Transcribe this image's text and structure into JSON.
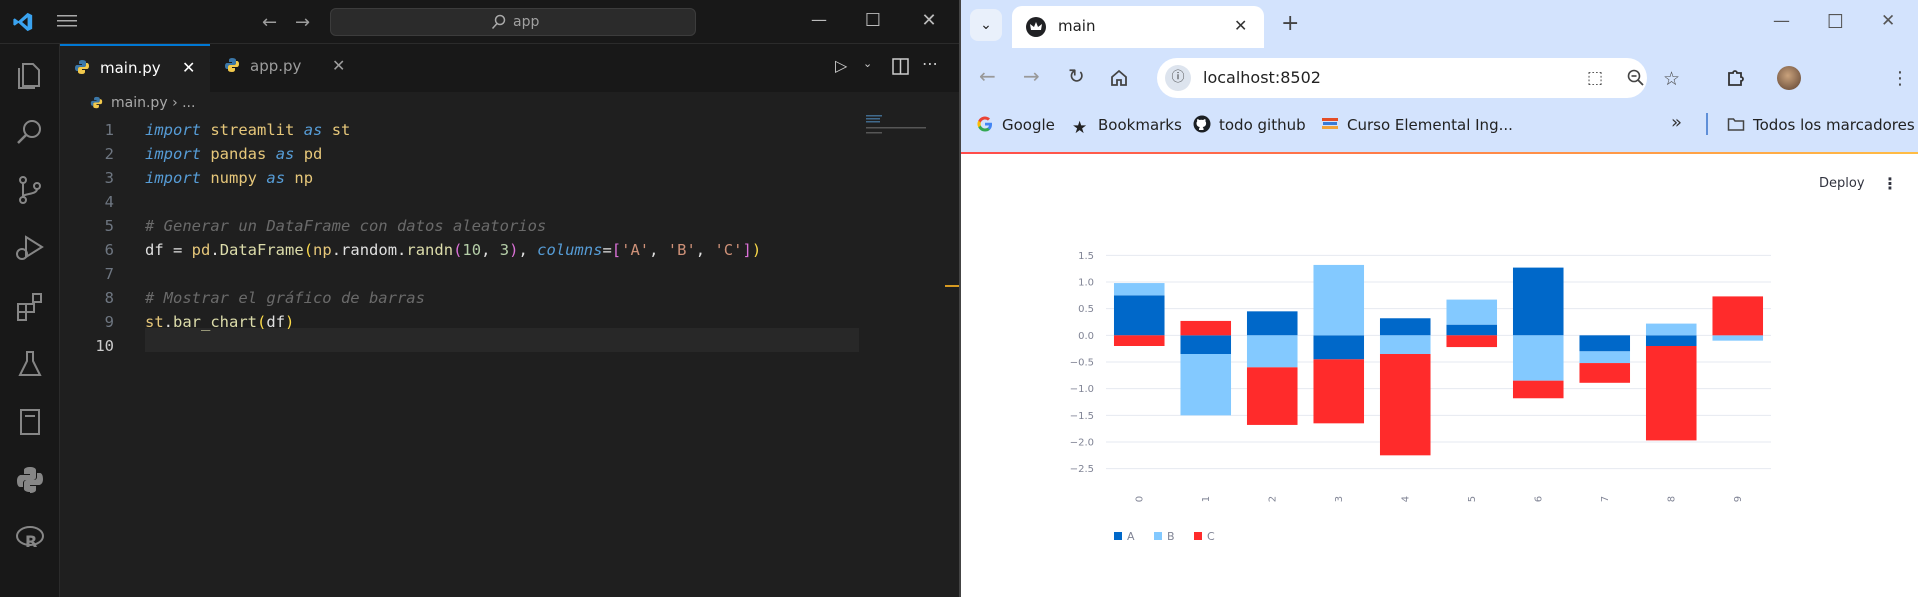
{
  "vscode": {
    "search_text": "app",
    "tabs": [
      {
        "label": "main.py",
        "active": true
      },
      {
        "label": "app.py",
        "active": false
      }
    ],
    "breadcrumb": {
      "file": "main.py",
      "rest": "› ..."
    },
    "code_lines": [
      {
        "n": "1",
        "tokens": [
          [
            "kw",
            "import"
          ],
          [
            "var",
            " "
          ],
          [
            "mod",
            "streamlit"
          ],
          [
            "var",
            " "
          ],
          [
            "kw",
            "as"
          ],
          [
            "var",
            " "
          ],
          [
            "mod",
            "st"
          ]
        ]
      },
      {
        "n": "2",
        "tokens": [
          [
            "kw",
            "import"
          ],
          [
            "var",
            " "
          ],
          [
            "mod",
            "pandas"
          ],
          [
            "var",
            " "
          ],
          [
            "kw",
            "as"
          ],
          [
            "var",
            " "
          ],
          [
            "mod",
            "pd"
          ]
        ]
      },
      {
        "n": "3",
        "tokens": [
          [
            "kw",
            "import"
          ],
          [
            "var",
            " "
          ],
          [
            "mod",
            "numpy"
          ],
          [
            "var",
            " "
          ],
          [
            "kw",
            "as"
          ],
          [
            "var",
            " "
          ],
          [
            "mod",
            "np"
          ]
        ]
      },
      {
        "n": "4",
        "tokens": []
      },
      {
        "n": "5",
        "tokens": [
          [
            "cm",
            "# Generar un DataFrame con datos aleatorios"
          ]
        ]
      },
      {
        "n": "6",
        "tokens": [
          [
            "var",
            "df = "
          ],
          [
            "mod",
            "pd"
          ],
          [
            "var",
            "."
          ],
          [
            "fn",
            "DataFrame"
          ],
          [
            "par",
            "("
          ],
          [
            "mod",
            "np"
          ],
          [
            "var",
            "."
          ],
          [
            "var",
            "random"
          ],
          [
            "var",
            "."
          ],
          [
            "fn",
            "randn"
          ],
          [
            "par2",
            "("
          ],
          [
            "num",
            "10"
          ],
          [
            "var",
            ", "
          ],
          [
            "num",
            "3"
          ],
          [
            "par2",
            ")"
          ],
          [
            "var",
            ", "
          ],
          [
            "kw",
            "columns"
          ],
          [
            "var",
            "="
          ],
          [
            "par2",
            "["
          ],
          [
            "str",
            "'A'"
          ],
          [
            "var",
            ", "
          ],
          [
            "str",
            "'B'"
          ],
          [
            "var",
            ", "
          ],
          [
            "str",
            "'C'"
          ],
          [
            "par2",
            "]"
          ],
          [
            "par",
            ")"
          ]
        ]
      },
      {
        "n": "7",
        "tokens": []
      },
      {
        "n": "8",
        "tokens": [
          [
            "cm",
            "# Mostrar el gráfico de barras"
          ]
        ]
      },
      {
        "n": "9",
        "tokens": [
          [
            "mod",
            "st"
          ],
          [
            "var",
            "."
          ],
          [
            "fn",
            "bar_chart"
          ],
          [
            "par",
            "("
          ],
          [
            "var",
            "df"
          ],
          [
            "par",
            ")"
          ]
        ]
      },
      {
        "n": "10",
        "tokens": []
      }
    ]
  },
  "browser": {
    "tab_title": "main",
    "url": "localhost:8502",
    "bookmarks": [
      "Google",
      "Bookmarks",
      "todo github",
      "Curso Elemental Ing...",
      "Todos los marcadores"
    ],
    "deploy_label": "Deploy"
  },
  "colors": {
    "A": "#0068c9",
    "B": "#83c9ff",
    "C": "#ff2b2b",
    "accent": "#0078d4"
  },
  "chart_data": {
    "type": "bar",
    "stacked": true,
    "categories": [
      "0",
      "1",
      "2",
      "3",
      "4",
      "5",
      "6",
      "7",
      "8",
      "9"
    ],
    "series": [
      {
        "name": "A",
        "values": [
          0.75,
          -0.35,
          0.45,
          -0.45,
          0.32,
          0.2,
          1.27,
          -0.3,
          -0.2,
          0.0
        ]
      },
      {
        "name": "B",
        "values": [
          0.23,
          -1.15,
          -0.6,
          1.32,
          -0.35,
          0.47,
          -0.85,
          -0.22,
          0.22,
          -0.1
        ]
      },
      {
        "name": "C",
        "values": [
          -0.2,
          0.27,
          -1.08,
          -1.2,
          -1.9,
          -0.22,
          -0.33,
          -0.37,
          -1.77,
          0.73
        ]
      }
    ],
    "ylim": [
      -2.6,
      1.6
    ],
    "yticks": [
      "1.5",
      "1.0",
      "0.5",
      "0.0",
      "−0.5",
      "−1.0",
      "−1.5",
      "−2.0",
      "−2.5"
    ],
    "ytick_values": [
      1.5,
      1.0,
      0.5,
      0.0,
      -0.5,
      -1.0,
      -1.5,
      -2.0,
      -2.5
    ],
    "legend": [
      "A",
      "B",
      "C"
    ],
    "legend_position": "bottom-left",
    "grid": true
  }
}
